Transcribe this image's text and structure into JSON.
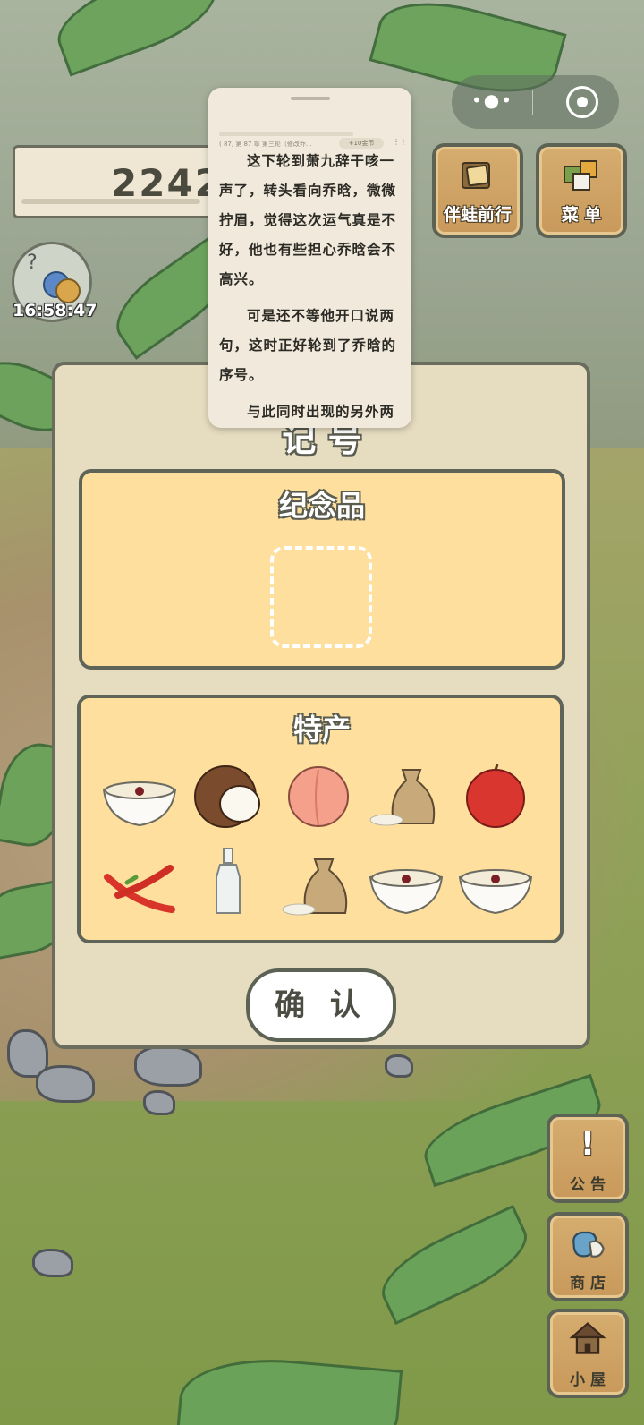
{
  "hud": {
    "clover_count": "2242",
    "time": "16:58:47"
  },
  "top_buttons": {
    "travel_label": "伴蛙前行",
    "menu_label": "菜 单"
  },
  "reader": {
    "meta": "( 87, 第 87 章 第三轮（修改乔…",
    "chip": "+10金币",
    "paragraphs": [
      "这下轮到萧九辞干咳一声了，转头看向乔晗，微微拧眉，觉得这次运气真是不好，他也有些担心乔晗会不高兴。",
      "可是还不等他开口说两句，这时正好轮到了乔晗的序号。",
      "与此同时出现的另外两道声音让萧九辞的脸色瞬间变"
    ]
  },
  "panel": {
    "title": "记 号",
    "souvenir_title": "纪念品",
    "specialty_title": "特产",
    "specialty_items": [
      "rice-pudding",
      "coconut",
      "peach",
      "rice-sack",
      "apple",
      "chili-peppers",
      "glass-bottle",
      "rice-sack",
      "rice-pudding",
      "rice-pudding"
    ],
    "confirm_label": "确 认"
  },
  "side_buttons": {
    "notice_glyph": "!",
    "notice_label": "公 告",
    "shop_label": "商 店",
    "house_label": "小 屋"
  }
}
